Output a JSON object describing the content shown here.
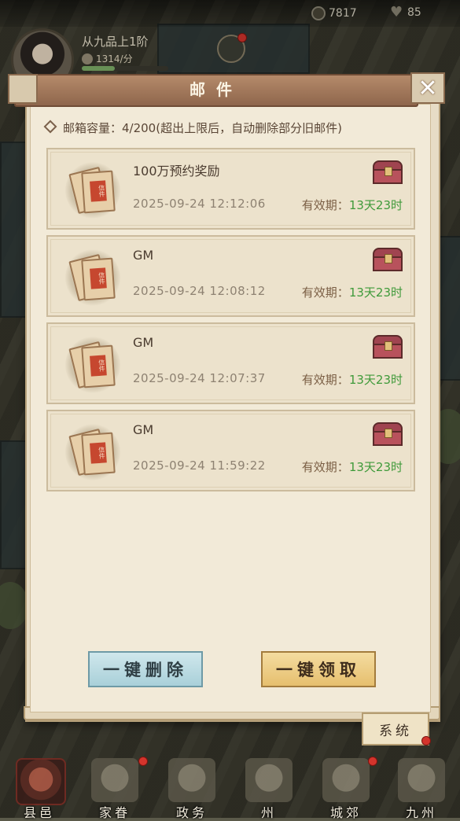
{
  "topbar": {
    "coins": "7817",
    "hearts": "85"
  },
  "player": {
    "rank": "从九品上1阶",
    "rate": "1314/分"
  },
  "mail_dialog": {
    "title": "邮件",
    "capacity_text": "邮箱容量：4/200(超出上限后，自动删除部分旧邮件)",
    "envelope_seal": "信件",
    "valid_label": "有效期：",
    "mails": [
      {
        "title": "100万预约奖励",
        "date": "2025-09-24  12:12:06",
        "valid": "13天23时"
      },
      {
        "title": "GM",
        "date": "2025-09-24  12:08:12",
        "valid": "13天23时"
      },
      {
        "title": "GM",
        "date": "2025-09-24  12:07:37",
        "valid": "13天23时"
      },
      {
        "title": "GM",
        "date": "2025-09-24  11:59:22",
        "valid": "13天23时"
      }
    ],
    "delete_all_label": "一键删除",
    "claim_all_label": "一键领取",
    "tab_system": "系统"
  },
  "nav": {
    "items": [
      {
        "label": "县邑"
      },
      {
        "label": "家眷"
      },
      {
        "label": "政务"
      },
      {
        "label": "州"
      },
      {
        "label": "城郊"
      },
      {
        "label": "九州"
      }
    ]
  },
  "colors": {
    "valid_green": "#3f9a3a",
    "title_bar": "#9a6f52",
    "claim_button": "#e6bf6e",
    "delete_button": "#a9d0d9",
    "notification_dot": "#d4342c"
  }
}
